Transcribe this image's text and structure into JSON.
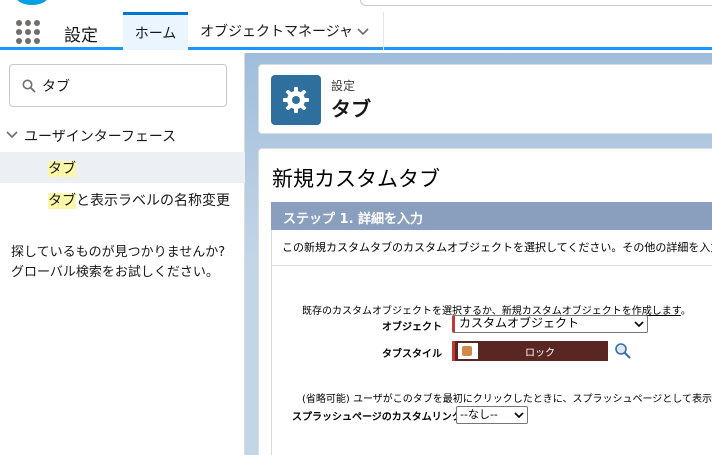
{
  "header": {
    "app_name": "設定",
    "tabs": [
      {
        "label": "ホーム",
        "active": true
      },
      {
        "label": "オブジェクトマネージャ",
        "has_menu": true
      }
    ]
  },
  "sidebar": {
    "quick_find": {
      "value": "タブ"
    },
    "tree": {
      "section_label": "ユーザインターフェース",
      "items": [
        {
          "highlight": "タブ",
          "rest": "",
          "selected": true
        },
        {
          "highlight": "タブ",
          "rest": "と表示ラベルの名称変更",
          "selected": false
        }
      ]
    },
    "not_found_text": "探しているものが見つかりませんか? グローバル検索をお試しください。"
  },
  "page_header": {
    "eyebrow": "設定",
    "title": "タブ"
  },
  "content": {
    "title": "新規カスタムタブ",
    "step_label": "ステップ 1. 詳細を入力",
    "step_description": "この新規カスタムタブのカスタムオブジェクトを選択してください。その他の詳細を入力してください",
    "instruction_prefix": "既存のカスタムオブジェクトを選択するか、",
    "instruction_link": "新規カスタムオブジェクトを作成します",
    "instruction_suffix": "。",
    "object_label": "オブジェクト",
    "object_value": "カスタムオブジェクト",
    "tab_style_label": "タブスタイル",
    "tab_style_value": "ロック",
    "splash_description": "(省略可能) ユーザがこのタブを最初にクリックしたときに、スプラッシュページとして表示されるホームペ",
    "splash_label": "スプラッシュページのカスタムリンク",
    "splash_value": "--なし--"
  },
  "colors": {
    "brand_blue": "#0176d3",
    "step_bar": "#8a9ebe",
    "required_red": "#c23934",
    "tab_style_bg": "#5a2622",
    "highlight": "#fdf7a9"
  },
  "icons": [
    "app-launcher-icon",
    "chevron-down-icon",
    "search-icon",
    "gear-icon",
    "lock-icon",
    "lookup-icon"
  ]
}
